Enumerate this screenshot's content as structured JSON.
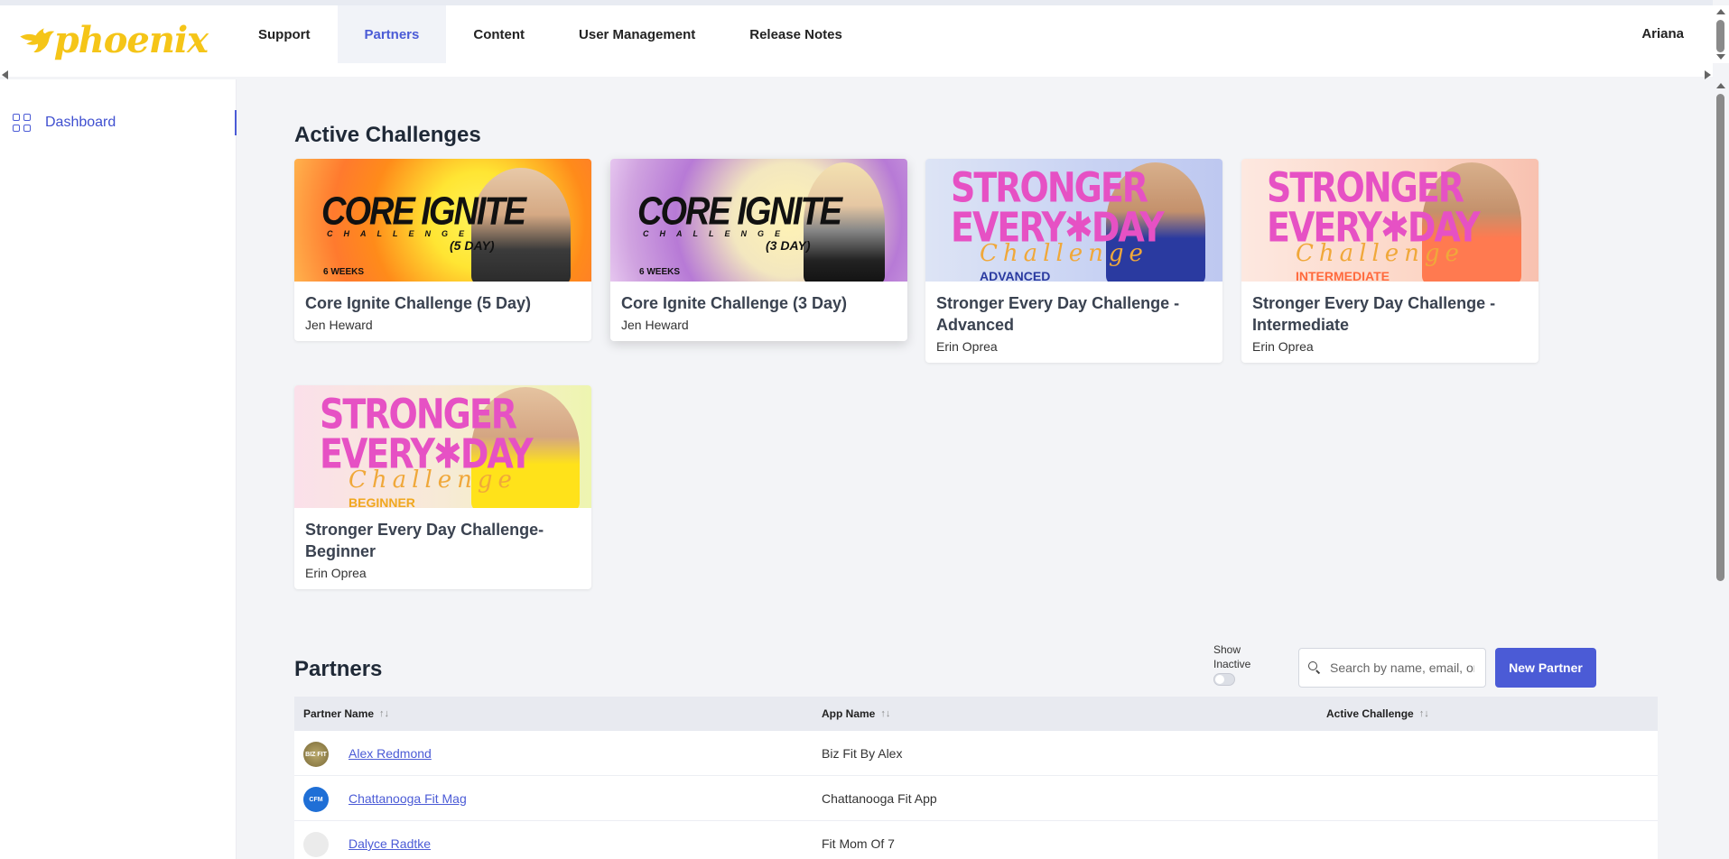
{
  "app": {
    "brand": "phoenix",
    "user_name": "Ariana"
  },
  "nav": {
    "items": [
      {
        "label": "Support"
      },
      {
        "label": "Partners"
      },
      {
        "label": "Content"
      },
      {
        "label": "User Management"
      },
      {
        "label": "Release Notes"
      }
    ],
    "active": "Partners"
  },
  "sidebar": {
    "items": [
      {
        "label": "Dashboard",
        "icon": "dashboard-grid-icon"
      }
    ]
  },
  "challenges": {
    "title": "Active Challenges",
    "cards": [
      {
        "title": "Core Ignite Challenge (5 Day)",
        "author": "Jen Heward",
        "img_word": "CORE IGNITE",
        "img_sub": "CHALLENGE",
        "img_days": "(5 DAY)",
        "img_weeks": "6 WEEKS"
      },
      {
        "title": "Core Ignite Challenge (3 Day)",
        "author": "Jen Heward",
        "img_word": "CORE IGNITE",
        "img_sub": "CHALLENGE",
        "img_days": "(3 DAY)",
        "img_weeks": "6 WEEKS"
      },
      {
        "title": "Stronger Every Day Challenge - Advanced",
        "author": "Erin Oprea",
        "img_l1": "STRONGER",
        "img_l2": "EVERY✱DAY",
        "img_ch": "Challenge",
        "img_lvl": "ADVANCED"
      },
      {
        "title": "Stronger Every Day Challenge - Intermediate",
        "author": "Erin Oprea",
        "img_l1": "STRONGER",
        "img_l2": "EVERY✱DAY",
        "img_ch": "Challenge",
        "img_lvl": "INTERMEDIATE"
      },
      {
        "title": "Stronger Every Day Challenge- Beginner",
        "author": "Erin Oprea",
        "img_l1": "STRONGER",
        "img_l2": "EVERY✱DAY",
        "img_ch": "Challenge",
        "img_lvl": "BEGINNER"
      }
    ]
  },
  "partners": {
    "title": "Partners",
    "show_inactive_label": "Show Inactive",
    "show_inactive": false,
    "search_placeholder": "Search by name, email, or app",
    "new_button": "New Partner",
    "columns": [
      "Partner Name",
      "App Name",
      "Active Challenge"
    ],
    "sort_glyph": "↑↓",
    "rows": [
      {
        "name": "Alex Redmond",
        "app": "Biz Fit By Alex",
        "challenge": "",
        "avatar_text": "BIZ FIT"
      },
      {
        "name": "Chattanooga Fit Mag",
        "app": "Chattanooga Fit App",
        "challenge": "",
        "avatar_text": "CFM"
      },
      {
        "name": "Dalyce Radtke",
        "app": "Fit Mom Of 7",
        "challenge": "",
        "avatar_text": ""
      }
    ]
  },
  "colors": {
    "accent": "#4b5bd6",
    "brand_yellow": "#f5c518",
    "magenta": "#e651c4"
  }
}
